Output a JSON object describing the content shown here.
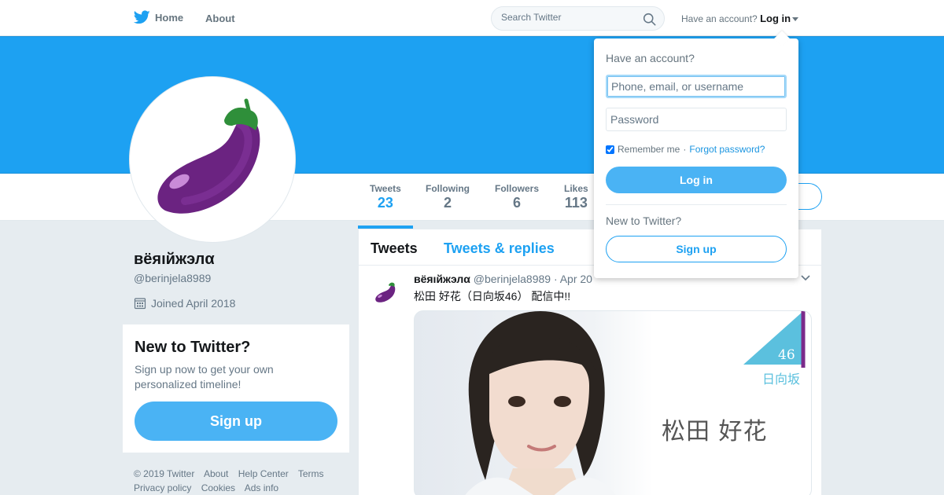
{
  "topnav": {
    "home_label": "Home",
    "about_label": "About",
    "search_placeholder": "Search Twitter",
    "have_account": "Have an account?",
    "login_label": "Log in"
  },
  "profile": {
    "name": "вёяıйжэлα",
    "handle": "@berinjela8989",
    "joined": "Joined April 2018",
    "avatar_icon": "eggplant-icon"
  },
  "stats": [
    {
      "label": "Tweets",
      "value": "23"
    },
    {
      "label": "Following",
      "value": "2"
    },
    {
      "label": "Followers",
      "value": "6"
    },
    {
      "label": "Likes",
      "value": "113"
    }
  ],
  "signup_card": {
    "title": "New to Twitter?",
    "text": "Sign up now to get your own personalized timeline!",
    "button": "Sign up"
  },
  "footer": {
    "line1": [
      "© 2019 Twitter",
      "About",
      "Help Center",
      "Terms"
    ],
    "line2": [
      "Privacy policy",
      "Cookies",
      "Ads info"
    ]
  },
  "timeline": {
    "tab_tweets": "Tweets",
    "tab_replies": "Tweets & replies",
    "tweet": {
      "name": "вёяıйжэлα",
      "handle": "@berinjela8989",
      "date": "· Apr 20",
      "text": "松田 好花（日向坂46） 配信中!!",
      "media_name": "松田 好花",
      "media_logo_text": "日向坂",
      "media_logo_num": "46"
    }
  },
  "login_dropdown": {
    "title": "Have an account?",
    "username_placeholder": "Phone, email, or username",
    "password_placeholder": "Password",
    "remember": "Remember me",
    "separator": "·",
    "forgot": "Forgot password?",
    "login_button": "Log in",
    "new_to_twitter": "New to Twitter?",
    "signup_button": "Sign up"
  },
  "colors": {
    "brand": "#1da1f2",
    "button": "#4ab3f4",
    "background": "#e6ecf0"
  }
}
